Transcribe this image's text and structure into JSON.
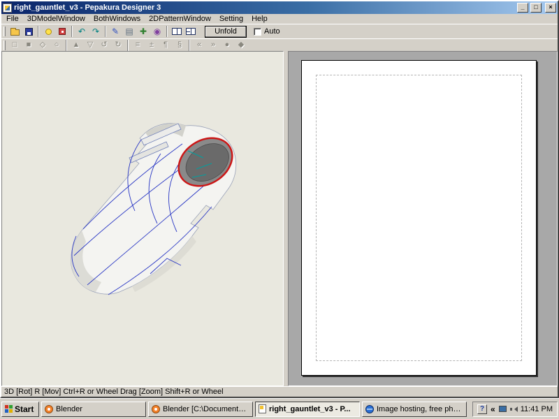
{
  "colors": {
    "titlebar_left": "#0a246a",
    "titlebar_right": "#a6caf0",
    "chrome_gray": "#d4d0c8",
    "viewport_bg": "#e9e8df",
    "pattern_bg": "#a8a8a8",
    "wireframe_blue": "#2735c4",
    "open_edge_red": "#cc1616"
  },
  "window": {
    "title": "right_gauntlet_v3 - Pepakura Designer 3",
    "controls": {
      "minimize": "_",
      "restore": "□",
      "close": "×"
    }
  },
  "menu": {
    "items": [
      "File",
      "3DModelWindow",
      "BothWindows",
      "2DPatternWindow",
      "Setting",
      "Help"
    ]
  },
  "toolbar": {
    "unfold_label": "Unfold",
    "auto_label": "Auto",
    "row1": [
      {
        "name": "open",
        "glyph": ""
      },
      {
        "name": "save",
        "glyph": ""
      },
      {
        "name": "light-toggle",
        "glyph": ""
      },
      {
        "name": "texture-setting",
        "glyph": ""
      },
      {
        "name": "undo",
        "glyph": "↶"
      },
      {
        "name": "redo",
        "glyph": "↷"
      },
      {
        "name": "edit-mode",
        "glyph": "✎"
      },
      {
        "name": "parts-list",
        "glyph": "▤"
      },
      {
        "name": "add-part",
        "glyph": "✚"
      },
      {
        "name": "view-mode",
        "glyph": "◉"
      },
      {
        "name": "window-both",
        "glyph": ""
      },
      {
        "name": "window-2d",
        "glyph": ""
      }
    ],
    "row2": [
      {
        "name": "select-tool",
        "glyph": "□"
      },
      {
        "name": "move-part",
        "glyph": "■"
      },
      {
        "name": "rotate-part",
        "glyph": "◇"
      },
      {
        "name": "zoom-tool",
        "glyph": "○"
      },
      {
        "name": "pan-tool",
        "glyph": "▲"
      },
      {
        "name": "flip-part",
        "glyph": "▽"
      },
      {
        "name": "rotate-ccw",
        "glyph": "↺"
      },
      {
        "name": "rotate-cw",
        "glyph": "↻"
      },
      {
        "name": "edge-list",
        "glyph": "≡"
      },
      {
        "name": "adjust-flap",
        "glyph": "±"
      },
      {
        "name": "add-text",
        "glyph": "¶"
      },
      {
        "name": "add-image",
        "glyph": "§"
      },
      {
        "name": "prev-page",
        "glyph": "«"
      },
      {
        "name": "next-page",
        "glyph": "»"
      },
      {
        "name": "mark-dot",
        "glyph": "●"
      },
      {
        "name": "mark-diamond",
        "glyph": "◆"
      }
    ]
  },
  "statusbar": {
    "text": "3D [Rot] R [Mov] Ctrl+R or Wheel Drag [Zoom] Shift+R or Wheel"
  },
  "taskbar": {
    "start_label": "Start",
    "items": [
      {
        "label": "Blender"
      },
      {
        "label": "Blender [C:\\Documents a...]"
      },
      {
        "label": "right_gauntlet_v3 - P...",
        "active": true
      },
      {
        "label": "Image hosting, free phot..."
      }
    ],
    "tray": {
      "help": "?",
      "chevron": "«",
      "clock": "11:41 PM"
    }
  }
}
